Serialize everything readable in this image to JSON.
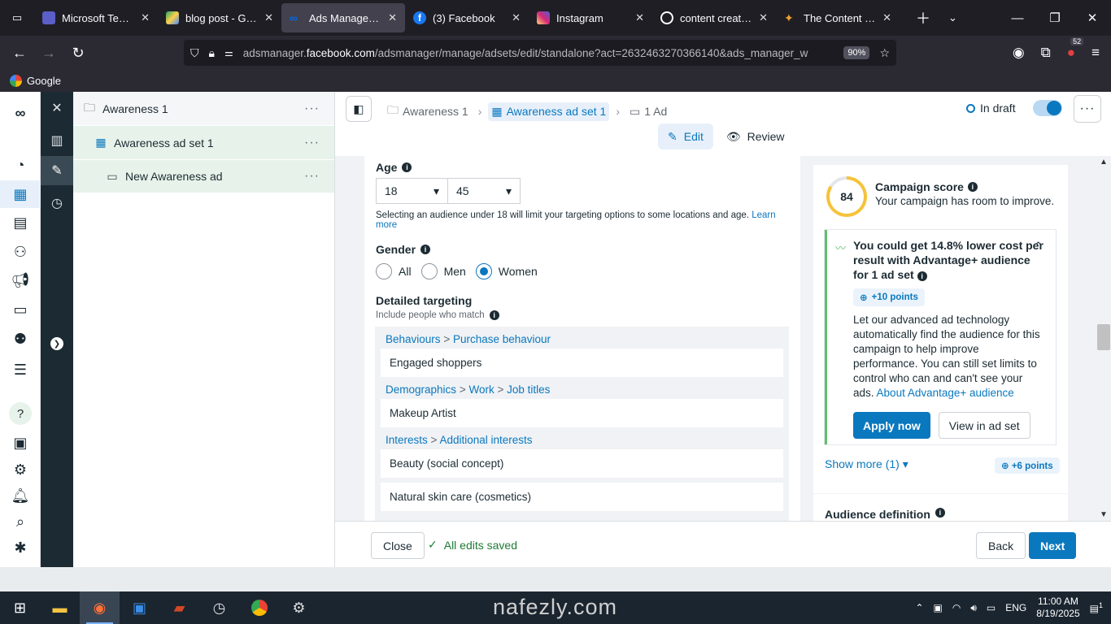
{
  "browser": {
    "tabs": [
      {
        "title": "Microsoft Teams",
        "favicon_color": "#5b5fc7",
        "active": false
      },
      {
        "title": "blog post - Googl",
        "favicon_color": "#1fa463",
        "active": false
      },
      {
        "title": "Ads Manager - M",
        "favicon_color": "#0668e1",
        "active": true
      },
      {
        "title": "(3) Facebook",
        "favicon_color": "#1877f2",
        "active": false
      },
      {
        "title": "Instagram",
        "favicon_color": "#e1306c",
        "active": false
      },
      {
        "title": "content creator - ",
        "favicon_color": "#ffffff",
        "active": false
      },
      {
        "title": "The Content Crea",
        "favicon_color": "#f0a030",
        "active": false
      }
    ],
    "url_host": "adsmanager.facebook.com",
    "url_prefix": "adsmanager.",
    "url_domain": "facebook.com",
    "url_path": "/adsmanager/manage/adsets/edit/standalone?act=2632463270366140&ads_manager_w",
    "zoom": "90%",
    "extension_count": "52",
    "bookmark": "Google"
  },
  "tree": {
    "campaign": "Awareness 1",
    "adset": "Awareness ad set 1",
    "ad": "New Awareness ad",
    "more": "···"
  },
  "header": {
    "crumbs": [
      "Awareness 1",
      "Awareness ad set 1",
      "1 Ad"
    ],
    "status": "In draft",
    "edit": "Edit",
    "review": "Review",
    "more": "···"
  },
  "form": {
    "age_label": "Age",
    "age_min": "18",
    "age_max": "45",
    "age_note": "Selecting an audience under 18 will limit your targeting options to some locations and age.",
    "learn_more": "Learn more",
    "gender_label": "Gender",
    "gender_options": [
      "All",
      "Men",
      "Women"
    ],
    "gender_selected": "Women",
    "detailed_label": "Detailed targeting",
    "include_label": "Include people who match",
    "groups": [
      {
        "path": [
          "Behaviours",
          "Purchase behaviour"
        ],
        "items": [
          "Engaged shoppers"
        ]
      },
      {
        "path": [
          "Demographics",
          "Work",
          "Job titles"
        ],
        "items": [
          "Makeup Artist"
        ]
      },
      {
        "path": [
          "Interests",
          "Additional interests"
        ],
        "items": [
          "Beauty (social concept)",
          "Natural skin care (cosmetics)"
        ]
      }
    ]
  },
  "score": {
    "value": "84",
    "value_num": 84,
    "title": "Campaign score",
    "subtitle": "Your campaign has room to improve.",
    "reco_title": "You could get 14.8% lower cost per result with Advantage+ audience for 1 ad set",
    "points": "+10 points",
    "body": "Let our advanced ad technology automatically find the audience for this campaign to help improve performance. You can still set limits to control who can and can't see your ads.",
    "about_link": "About Advantage+ audience",
    "apply": "Apply now",
    "view": "View in ad set",
    "show_more": "Show more (1)",
    "points2": "+6 points",
    "audience_def": "Audience definition"
  },
  "footer": {
    "close": "Close",
    "saved": "All edits saved",
    "back": "Back",
    "next": "Next"
  },
  "watermark": "nafezly.com",
  "taskbar": {
    "lang": "ENG",
    "time": "11:00 AM",
    "date": "8/19/2025",
    "notif": "1"
  }
}
